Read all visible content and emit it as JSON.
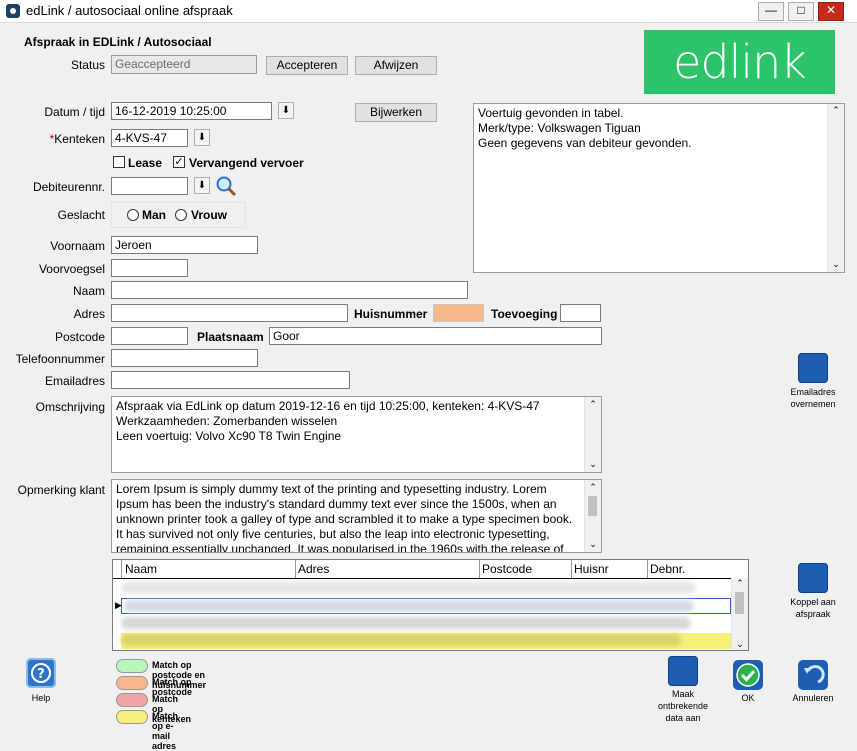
{
  "window": {
    "title": "edLink / autosociaal online afspraak",
    "minimize": "—",
    "maximize": "□",
    "close": "✕"
  },
  "header": {
    "heading": "Afspraak in EDLink / Autosociaal",
    "logo_text": "edlink"
  },
  "status": {
    "label": "Status",
    "value": "Geaccepteerd",
    "accept_label": "Accepteren",
    "reject_label": "Afwijzen"
  },
  "form": {
    "datetime_label": "Datum / tijd",
    "datetime_value": "16-12-2019 10:25:00",
    "update_label": "Bijwerken",
    "plate_label": "Kenteken",
    "plate_required": "*",
    "plate_value": "4-KVS-47",
    "lease_label": "Lease",
    "replacement_label": "Vervangend vervoer",
    "debtor_label": "Debiteurennr.",
    "debtor_value": "",
    "gender_label": "Geslacht",
    "male_label": "Man",
    "female_label": "Vrouw",
    "firstname_label": "Voornaam",
    "firstname_value": "Jeroen",
    "prefix_label": "Voorvoegsel",
    "prefix_value": "",
    "name_label": "Naam",
    "name_value": "",
    "address_label": "Adres",
    "address_value": "",
    "housenr_label": "Huisnummer",
    "addition_label": "Toevoeging",
    "postcode_label": "Postcode",
    "postcode_value": "",
    "city_label": "Plaatsnaam",
    "city_value": "Goor",
    "phone_label": "Telefoonnummer",
    "phone_value": "",
    "email_label": "Emailadres",
    "email_value": ""
  },
  "info_box": {
    "lines": [
      "Voertuig gevonden in tabel.",
      "Merk/type: Volkswagen Tiguan",
      "Geen gegevens van debiteur gevonden."
    ]
  },
  "description": {
    "label": "Omschrijving",
    "lines": [
      "Afspraak via EdLink op datum 2019-12-16 en tijd 10:25:00, kenteken: 4-KVS-47",
      "Werkzaamheden: Zomerbanden wisselen",
      "Leen voertuig: Volvo Xc90 T8 Twin Engine"
    ]
  },
  "remark": {
    "label": "Opmerking klant",
    "text": "Lorem Ipsum is simply dummy text of the printing and typesetting industry. Lorem Ipsum has been the industry's standard dummy text ever since the 1500s, when an unknown printer took a galley of type and scrambled it to make a type specimen book. It has survived not only five centuries, but also the leap into electronic typesetting, remaining essentially unchanged. It was popularised in the 1960s with the release of"
  },
  "grid": {
    "columns": [
      "Naam",
      "Adres",
      "Postcode",
      "Huisnr",
      "Debnr."
    ]
  },
  "side_buttons": {
    "email_copy": "Emailadres overnemen",
    "link": "Koppel aan afspraak"
  },
  "legend": [
    {
      "label": "Match op postcode en huisnummer",
      "color": "#b9f5b9"
    },
    {
      "label": "Match op postcode",
      "color": "#f7b788"
    },
    {
      "label": "Match op kenteken",
      "color": "#f2a4a4"
    },
    {
      "label": "Match op e-mail adres",
      "color": "#f5f07a"
    }
  ],
  "footer": {
    "help": "Help",
    "create_missing": "Maak ontbrekende data aan",
    "ok": "OK",
    "cancel": "Annuleren"
  },
  "colors": {
    "accent": "#1d5eb2",
    "logo_bg": "#2dc36a",
    "housenr_highlight": "#f7b788",
    "row_yellow": "#f5f07a"
  }
}
